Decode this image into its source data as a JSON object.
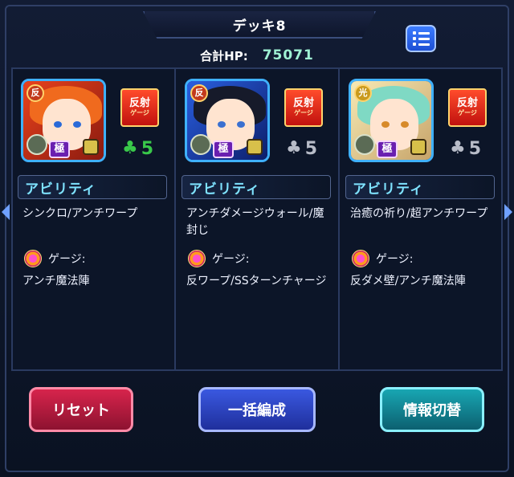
{
  "header": {
    "deck_title": "デッキ8",
    "hp_label": "合計HP:",
    "hp_value": "75071",
    "menu_icon": "list-menu-icon"
  },
  "characters": [
    {
      "badge_top": "反",
      "hansha_main": "反射",
      "hansha_sub": "ゲージ",
      "kiwami": "極",
      "luck": "5",
      "luck_color": "#39c84a",
      "ability_header": "アビリティ",
      "ability_text": "シンクロ/アンチワープ",
      "gauge_label": "ゲージ:",
      "gauge_text": "アンチ魔法陣"
    },
    {
      "badge_top": "反",
      "hansha_main": "反射",
      "hansha_sub": "ゲージ",
      "kiwami": "極",
      "luck": "5",
      "luck_color": "#b8bcc8",
      "ability_header": "アビリティ",
      "ability_text": "アンチダメージウォール/魔封じ",
      "gauge_label": "ゲージ:",
      "gauge_text": "反ワープ/SSターンチャージ"
    },
    {
      "badge_top": "光",
      "hansha_main": "反射",
      "hansha_sub": "ゲージ",
      "kiwami": "極",
      "luck": "5",
      "luck_color": "#b8bcc8",
      "ability_header": "アビリティ",
      "ability_text": "治癒の祈り/超アンチワープ",
      "gauge_label": "ゲージ:",
      "gauge_text": "反ダメ壁/アンチ魔法陣"
    }
  ],
  "buttons": {
    "reset": "リセット",
    "bulk_edit": "一括編成",
    "info_toggle": "情報切替"
  }
}
